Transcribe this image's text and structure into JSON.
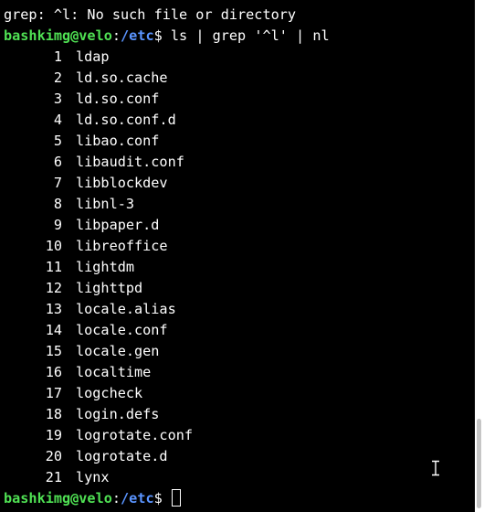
{
  "terminal": {
    "error_line": "grep: ^l: No such file or directory",
    "prompt": {
      "user_host": "bashkimg@velo",
      "separator": ":",
      "path": "/etc",
      "dollar": "$ ",
      "command": "ls | grep '^l' | nl"
    },
    "output": [
      {
        "n": "1",
        "name": "ldap"
      },
      {
        "n": "2",
        "name": "ld.so.cache"
      },
      {
        "n": "3",
        "name": "ld.so.conf"
      },
      {
        "n": "4",
        "name": "ld.so.conf.d"
      },
      {
        "n": "5",
        "name": "libao.conf"
      },
      {
        "n": "6",
        "name": "libaudit.conf"
      },
      {
        "n": "7",
        "name": "libblockdev"
      },
      {
        "n": "8",
        "name": "libnl-3"
      },
      {
        "n": "9",
        "name": "libpaper.d"
      },
      {
        "n": "10",
        "name": "libreoffice"
      },
      {
        "n": "11",
        "name": "lightdm"
      },
      {
        "n": "12",
        "name": "lighttpd"
      },
      {
        "n": "13",
        "name": "locale.alias"
      },
      {
        "n": "14",
        "name": "locale.conf"
      },
      {
        "n": "15",
        "name": "locale.gen"
      },
      {
        "n": "16",
        "name": "localtime"
      },
      {
        "n": "17",
        "name": "logcheck"
      },
      {
        "n": "18",
        "name": "login.defs"
      },
      {
        "n": "19",
        "name": "logrotate.conf"
      },
      {
        "n": "20",
        "name": "logrotate.d"
      },
      {
        "n": "21",
        "name": "lynx"
      }
    ],
    "final_prompt": {
      "user_host": "bashkimg@velo",
      "separator": ":",
      "path": "/etc",
      "dollar": "$ "
    },
    "colors": {
      "background": "#000000",
      "text": "#ffffff",
      "user_host": "#4fe053",
      "path": "#5a94ff"
    }
  }
}
